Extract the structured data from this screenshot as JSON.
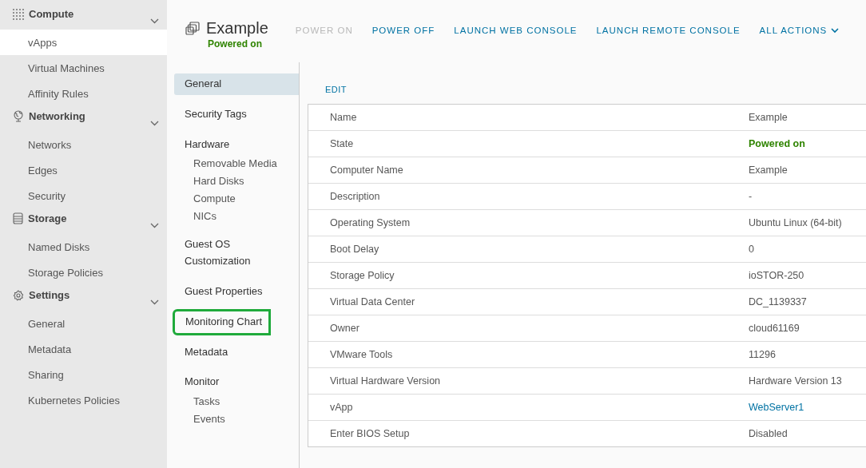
{
  "sidebar": {
    "groups": [
      {
        "label": "Compute",
        "kind": "grid",
        "expanded": true,
        "items": [
          {
            "label": "vApps",
            "selected": true
          },
          {
            "label": "Virtual Machines",
            "selected": false
          },
          {
            "label": "Affinity Rules",
            "selected": false
          }
        ]
      },
      {
        "label": "Networking",
        "kind": "globe",
        "expanded": true,
        "items": [
          {
            "label": "Networks",
            "selected": false
          },
          {
            "label": "Edges",
            "selected": false
          },
          {
            "label": "Security",
            "selected": false
          }
        ]
      },
      {
        "label": "Storage",
        "kind": "database",
        "expanded": true,
        "items": [
          {
            "label": "Named Disks",
            "selected": false
          },
          {
            "label": "Storage Policies",
            "selected": false
          }
        ]
      },
      {
        "label": "Settings",
        "kind": "gear",
        "expanded": true,
        "items": [
          {
            "label": "General",
            "selected": false
          },
          {
            "label": "Metadata",
            "selected": false
          },
          {
            "label": "Sharing",
            "selected": false
          },
          {
            "label": "Kubernetes Policies",
            "selected": false
          }
        ]
      }
    ]
  },
  "header": {
    "title": "Example",
    "status": "Powered on",
    "actions": [
      {
        "label": "POWER ON",
        "disabled": true,
        "dropdown": false
      },
      {
        "label": "POWER OFF",
        "disabled": false,
        "dropdown": false
      },
      {
        "label": "LAUNCH WEB CONSOLE",
        "disabled": false,
        "dropdown": false
      },
      {
        "label": "LAUNCH REMOTE CONSOLE",
        "disabled": false,
        "dropdown": false
      },
      {
        "label": "ALL ACTIONS",
        "disabled": false,
        "dropdown": true
      }
    ]
  },
  "detail_nav": [
    {
      "label": "General",
      "selected": true,
      "highlighted": false
    },
    {
      "label": "Security Tags",
      "selected": false,
      "highlighted": false
    },
    {
      "label": "Hardware",
      "selected": false,
      "highlighted": false,
      "children": [
        {
          "label": "Removable Media",
          "selected": false
        },
        {
          "label": "Hard Disks",
          "selected": false
        },
        {
          "label": "Compute",
          "selected": false
        },
        {
          "label": "NICs",
          "selected": false
        }
      ]
    },
    {
      "label": "Guest OS Customization",
      "selected": false,
      "highlighted": false
    },
    {
      "label": "Guest Properties",
      "selected": false,
      "highlighted": false
    },
    {
      "label": "Monitoring Chart",
      "selected": false,
      "highlighted": true
    },
    {
      "label": "Metadata",
      "selected": false,
      "highlighted": false
    },
    {
      "label": "Monitor",
      "selected": false,
      "highlighted": false,
      "children": [
        {
          "label": "Tasks",
          "selected": false
        },
        {
          "label": "Events",
          "selected": false
        }
      ]
    }
  ],
  "edit_link": "EDIT",
  "properties": [
    {
      "name": "Name",
      "value": "Example",
      "kind": "text"
    },
    {
      "name": "State",
      "value": "Powered on",
      "kind": "status"
    },
    {
      "name": "Computer Name",
      "value": "Example",
      "kind": "text"
    },
    {
      "name": "Description",
      "value": "-",
      "kind": "text"
    },
    {
      "name": "Operating System",
      "value": "Ubuntu Linux (64-bit)",
      "kind": "text"
    },
    {
      "name": "Boot Delay",
      "value": "0",
      "kind": "text"
    },
    {
      "name": "Storage Policy",
      "value": "ioSTOR-250",
      "kind": "text"
    },
    {
      "name": "Virtual Data Center",
      "value": "DC_1139337",
      "kind": "text"
    },
    {
      "name": "Owner",
      "value": "cloud61169",
      "kind": "text"
    },
    {
      "name": "VMware Tools",
      "value": "11296",
      "kind": "text"
    },
    {
      "name": "Virtual Hardware Version",
      "value": "Hardware Version 13",
      "kind": "text"
    },
    {
      "name": "vApp",
      "value": "WebServer1",
      "kind": "link"
    },
    {
      "name": "Enter BIOS Setup",
      "value": "Disabled",
      "kind": "text"
    }
  ]
}
